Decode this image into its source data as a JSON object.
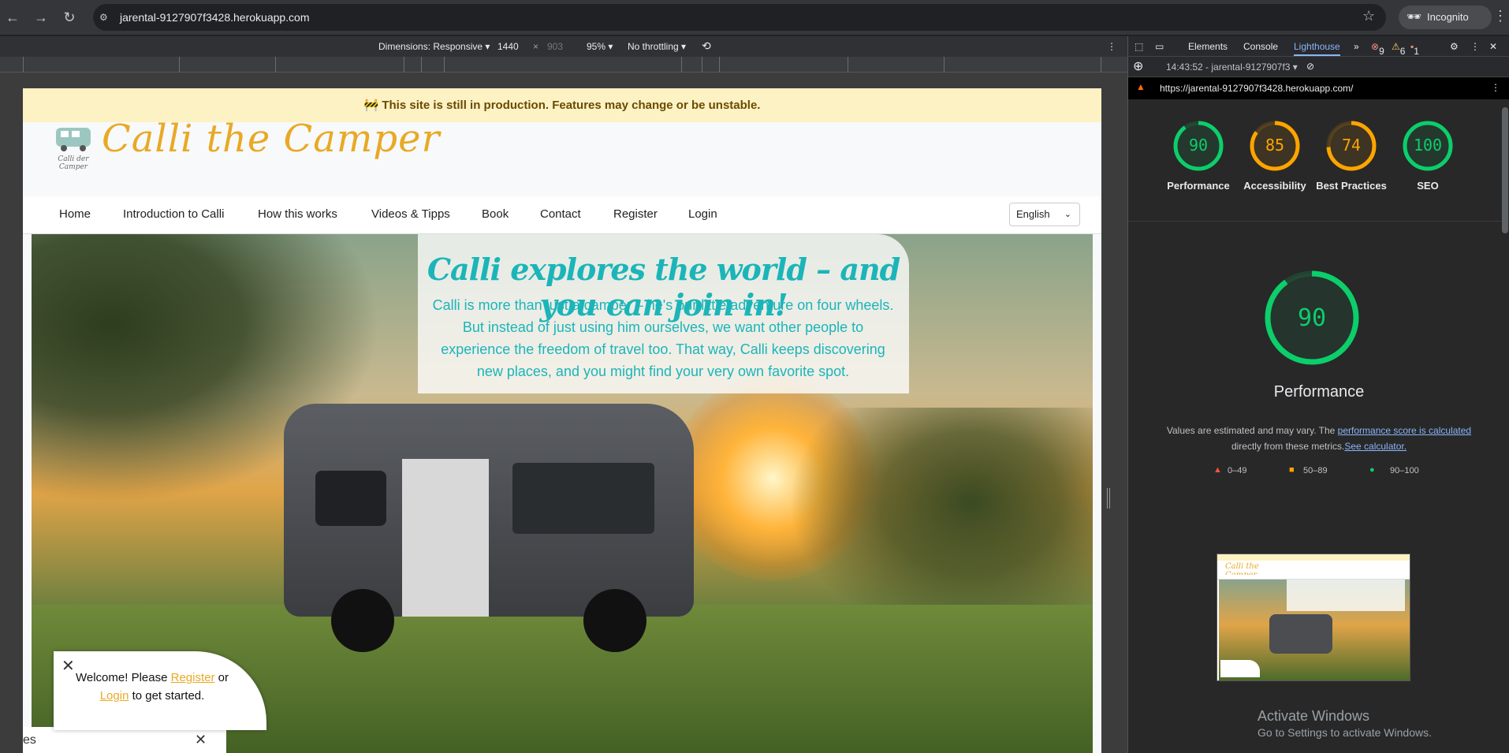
{
  "browser": {
    "url": "jarental-9127907f3428.herokuapp.com",
    "incognito_label": "Incognito"
  },
  "device_toolbar": {
    "dimensions_label": "Dimensions: Responsive",
    "width": "1440",
    "height": "903",
    "zoom": "95%",
    "throttling": "No throttling"
  },
  "site": {
    "banner": "🚧 This site is still in production. Features may change or be unstable.",
    "brand": "Calli the Camper",
    "logo_caption": "Calli der Camper",
    "nav": [
      "Home",
      "Introduction to Calli",
      "How this works",
      "Videos & Tipps",
      "Book",
      "Contact",
      "Register",
      "Login"
    ],
    "language": "English",
    "hero_title": "Calli explores the world – and you can join in!",
    "hero_body": "Calli is more than just a camper – he's our little adventure on four wheels. But instead of just using him ourselves, we want other people to experience the freedom of travel too. That way, Calli keeps discovering new places, and you might find your very own favorite spot.",
    "welcome_prefix": "Welcome! Please ",
    "welcome_register": "Register",
    "welcome_or": " or",
    "welcome_login": "Login",
    "welcome_suffix": " to get started.",
    "cookie_text": "es"
  },
  "devtools": {
    "tabs": [
      "Elements",
      "Console",
      "Lighthouse"
    ],
    "active_tab": "Lighthouse",
    "errors": "9",
    "warnings": "6",
    "issues": "1",
    "report_time": "14:43:52 - jarental-9127907f3",
    "report_url": "https://jarental-9127907f3428.herokuapp.com/",
    "scores": [
      {
        "label": "Performance",
        "value": "90",
        "color": "#0cce6b"
      },
      {
        "label": "Accessibility",
        "value": "85",
        "color": "#ffa400"
      },
      {
        "label": "Best Practices",
        "value": "74",
        "color": "#ffa400"
      },
      {
        "label": "SEO",
        "value": "100",
        "color": "#0cce6b"
      }
    ],
    "big_score": "90",
    "big_label": "Performance",
    "note_prefix": "Values are estimated and may vary. The ",
    "note_link1": "performance score is calculated",
    "note_middle": "directly from these metrics.",
    "note_link2": "See calculator.",
    "legend": [
      "0–49",
      "50–89",
      "90–100"
    ],
    "activate_title": "Activate Windows",
    "activate_sub": "Go to Settings to activate Windows."
  }
}
